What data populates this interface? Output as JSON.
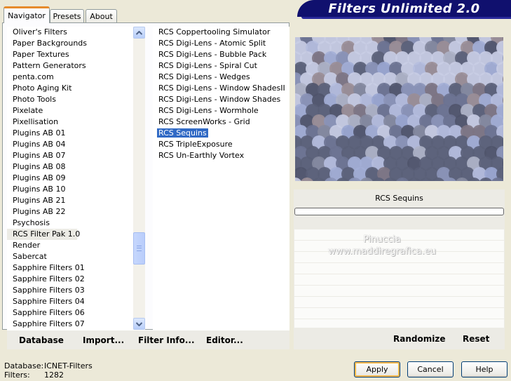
{
  "window": {
    "title": "Filters Unlimited 2.0"
  },
  "tabs": [
    {
      "label": "Navigator",
      "active": true
    },
    {
      "label": "Presets",
      "active": false
    },
    {
      "label": "About",
      "active": false
    }
  ],
  "categories": {
    "selected": "RCS Filter Pak 1.0",
    "items": [
      "Oliver's Filters",
      "Paper Backgrounds",
      "Paper Textures",
      "Pattern Generators",
      "penta.com",
      "Photo Aging Kit",
      "Photo Tools",
      "Pixelate",
      "Pixellisation",
      "Plugins AB 01",
      "Plugins AB 04",
      "Plugins AB 07",
      "Plugins AB 08",
      "Plugins AB 09",
      "Plugins AB 10",
      "Plugins AB 21",
      "Plugins AB 22",
      "Psychosis",
      "RCS Filter Pak 1.0",
      "Render",
      "Sabercat",
      "Sapphire Filters 01",
      "Sapphire Filters 02",
      "Sapphire Filters 03",
      "Sapphire Filters 04",
      "Sapphire Filters 06",
      "Sapphire Filters 07"
    ]
  },
  "filters": {
    "selected": "RCS Sequins",
    "items": [
      "RCS Coppertooling Simulator",
      "RCS Digi-Lens - Atomic Split",
      "RCS Digi-Lens - Bubble Pack",
      "RCS Digi-Lens - Spiral Cut",
      "RCS Digi-Lens - Wedges",
      "RCS Digi-Lens - Window ShadesII",
      "RCS Digi-Lens - Window Shades",
      "RCS Digi-Lens - Wormhole",
      "RCS ScreenWorks - Grid",
      "RCS Sequins",
      "RCS TripleExposure",
      "RCS Un-Earthly Vortex"
    ]
  },
  "toolbar": {
    "database": "Database",
    "import": "Import...",
    "filter_info": "Filter Info...",
    "editor": "Editor..."
  },
  "preview": {
    "filter_name": "RCS Sequins",
    "progress": 0
  },
  "watermark": {
    "line1": "Pinuccia",
    "line2": "www.maddiregrafica.eu"
  },
  "actions": {
    "randomize": "Randomize",
    "reset": "Reset"
  },
  "status": {
    "database_label": "Database:",
    "database_value": "ICNET-Filters",
    "filters_label": "Filters:",
    "filters_value": "1282"
  },
  "buttons": {
    "apply": "Apply",
    "cancel": "Cancel",
    "help": "Help"
  },
  "colors": {
    "banner": "#10106e",
    "selection": "#316ac5",
    "tab_accent": "#e68b2c"
  }
}
